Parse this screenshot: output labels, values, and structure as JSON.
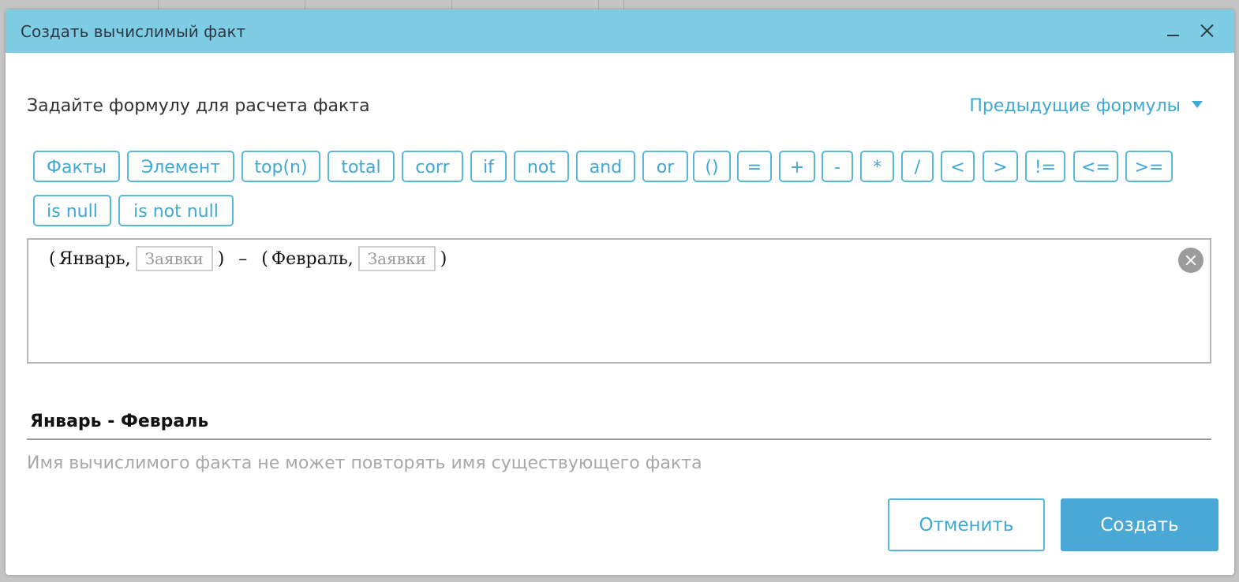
{
  "dialog": {
    "title": "Создать вычислимый факт"
  },
  "prompt": "Задайте формулу для расчета факта",
  "previous_formulas_label": "Предыдущие формулы",
  "operators_row1": [
    "Факты",
    "Элемент",
    "top(n)",
    "total",
    "corr",
    "if",
    "not",
    "and",
    "or",
    "()",
    "=",
    "+",
    "-",
    "*",
    "/",
    "<",
    ">",
    "!=",
    "<=",
    ">="
  ],
  "operators_row2": [
    "is null",
    "is not null"
  ],
  "formula": {
    "open1": "(",
    "element1": "Январь,",
    "chip1": "Заявки",
    "close1": ")",
    "minus": "–",
    "open2": "(",
    "element2": "Февраль,",
    "chip2": "Заявки",
    "close2": ")"
  },
  "fact_name_value": "Январь - Февраль",
  "hint": "Имя вычислимого факта не может повторять имя существующего факта",
  "buttons": {
    "cancel": "Отменить",
    "create": "Создать"
  },
  "colors": {
    "titlebar": "#7ecde4",
    "accent": "#3fa9d3",
    "primary_button": "#4aa8d6"
  }
}
